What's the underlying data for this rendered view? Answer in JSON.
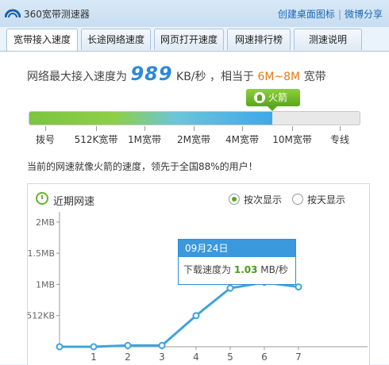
{
  "app": {
    "title": "360宽带测速器",
    "links": [
      "创建桌面图标",
      "微博分享"
    ]
  },
  "tabs": [
    {
      "label": "宽带接入速度",
      "active": true
    },
    {
      "label": "长途网络速度",
      "active": false
    },
    {
      "label": "网页打开速度",
      "active": false
    },
    {
      "label": "网速排行榜",
      "active": false
    },
    {
      "label": "测速说明",
      "active": false
    }
  ],
  "speed": {
    "prefix": "网络最大接入速度为",
    "value": "989",
    "unit": "KB/秒",
    "mid": "，相当于",
    "band": "6M~8M",
    "suffix": "宽带",
    "level_label": "火箭",
    "level_fraction": 0.735
  },
  "scale_labels": [
    "拨号",
    "512K宽带",
    "1M宽带",
    "2M宽带",
    "4M宽带",
    "10M宽带",
    "专线"
  ],
  "compare_text": "当前的网速就像火箭的速度，领先于全国88%的用户！",
  "chart_panel": {
    "title": "近期网速",
    "options": [
      {
        "label": "按次显示",
        "selected": true
      },
      {
        "label": "按天显示",
        "selected": false
      }
    ]
  },
  "tooltip": {
    "date": "09月24日",
    "label": "下载速度为",
    "value": "1.03",
    "unit": "MB/秒"
  },
  "colors": {
    "accent": "#3a98dc",
    "green": "#5aa61c",
    "orange": "#e37b12"
  },
  "chart_data": {
    "type": "line",
    "x": [
      0,
      1,
      2,
      3,
      4,
      5,
      6,
      7
    ],
    "xticks": [
      "1",
      "2",
      "3",
      "4",
      "5",
      "6",
      "7"
    ],
    "series": [
      {
        "values": [
          0,
          0,
          0.02,
          0.02,
          0.5,
          0.94,
          1.03,
          0.96
        ]
      }
    ],
    "yticks": [
      {
        "label": "512KB",
        "value": 0.5
      },
      {
        "label": "1MB",
        "value": 1
      },
      {
        "label": "1.5MB",
        "value": 1.5
      },
      {
        "label": "2MB",
        "value": 2
      }
    ],
    "ylim": [
      0,
      2.1
    ],
    "ylabel": "",
    "xlabel": ""
  }
}
